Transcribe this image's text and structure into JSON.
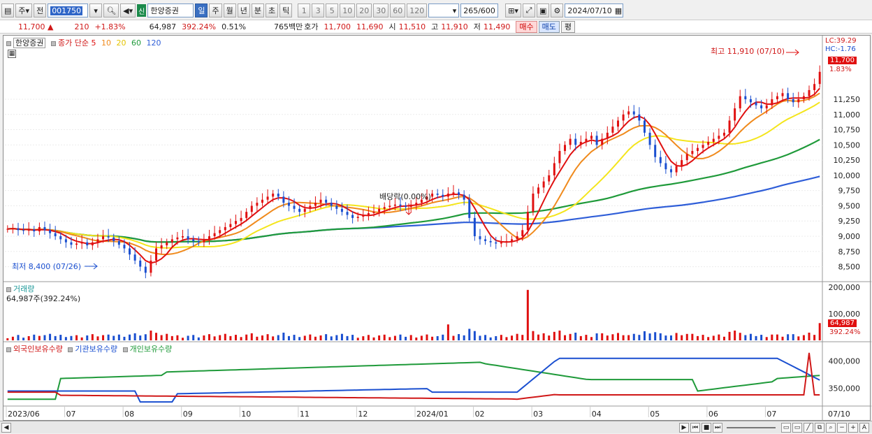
{
  "toolbar": {
    "period_btn": "주",
    "prev_btn": "전",
    "stock_code": "001750",
    "new_badge": "신",
    "stock_name": "한양증권",
    "tabs": [
      "일",
      "주",
      "월",
      "년",
      "분",
      "초",
      "틱"
    ],
    "active_tab": "일",
    "intervals": [
      "1",
      "3",
      "5",
      "10",
      "20",
      "30",
      "60",
      "120"
    ],
    "count": "265",
    "count_max": "/600",
    "date": "2024/07/10"
  },
  "quote": {
    "price": "11,700",
    "arrow": "▲",
    "change": "210",
    "change_pct": "+1.83%",
    "volume": "64,987",
    "vol_ratio": "392.24%",
    "turnover": "0.51%",
    "amount": "765백만",
    "hoga_label": "호가",
    "ask": "11,700",
    "bid": "11,690",
    "open_label": "시",
    "open": "11,510",
    "high_label": "고",
    "high": "11,910",
    "low_label": "저",
    "low": "11,490",
    "buy_btn": "매수",
    "sell_btn": "매도",
    "eval_btn": "평"
  },
  "price_panel": {
    "name": "한양증권",
    "ma_label": "종가 단순",
    "ma_periods": [
      {
        "label": "5",
        "color": "#e01010"
      },
      {
        "label": "10",
        "color": "#f08a1c"
      },
      {
        "label": "20",
        "color": "#f4e51c"
      },
      {
        "label": "60",
        "color": "#1f9a3a"
      },
      {
        "label": "120",
        "color": "#2f5ed8"
      }
    ],
    "lc": "LC:39.29",
    "hc": "HC:-1.76",
    "cur_price": "11,700",
    "cur_pct": "1.83%",
    "high_note": "최고 11,910 (07/10)",
    "low_note": "최저 8,400 (07/26)",
    "dividend_note": "배당락(0.00%)",
    "y_ticks": [
      "11,250",
      "11,000",
      "10,750",
      "10,500",
      "10,250",
      "10,000",
      "9,750",
      "9,500",
      "9,250",
      "9,000",
      "8,750",
      "8,500"
    ]
  },
  "volume_panel": {
    "title": "거래량",
    "subtitle": "64,987주(392.24%)",
    "y_ticks": [
      "200,000",
      "100,000"
    ],
    "cur": "64,987",
    "cur_pct": "392.24%"
  },
  "holding_panel": {
    "labels": [
      "외국인보유수량",
      "기관보유수량",
      "개인보유수량"
    ],
    "colors": [
      "#d01818",
      "#1a4fd0",
      "#1f9a3a"
    ],
    "y_ticks": [
      "400,000",
      "350,000"
    ]
  },
  "x_axis": [
    "2023/06",
    "07",
    "08",
    "09",
    "10",
    "11",
    "12",
    "2024/01",
    "02",
    "03",
    "04",
    "05",
    "06",
    "07"
  ],
  "x_end_label": "07/10",
  "chart_data": {
    "type": "candlestick",
    "ylim": [
      8300,
      11950
    ],
    "closes": [
      9120,
      9130,
      9100,
      9090,
      9110,
      9080,
      9150,
      9100,
      9050,
      9000,
      8950,
      8900,
      8860,
      8880,
      8900,
      8850,
      8900,
      8950,
      9000,
      8980,
      8920,
      8860,
      8800,
      8700,
      8600,
      8500,
      8400,
      8600,
      8800,
      8850,
      8900,
      8950,
      8980,
      9000,
      8950,
      8920,
      8900,
      8950,
      9000,
      9050,
      9100,
      9150,
      9200,
      9250,
      9300,
      9400,
      9500,
      9550,
      9600,
      9650,
      9700,
      9650,
      9550,
      9500,
      9450,
      9400,
      9450,
      9500,
      9550,
      9600,
      9550,
      9500,
      9450,
      9400,
      9350,
      9300,
      9320,
      9350,
      9380,
      9400,
      9450,
      9480,
      9500,
      9520,
      9500,
      9480,
      9520,
      9550,
      9600,
      9650,
      9700,
      9680,
      9650,
      9700,
      9720,
      9680,
      9600,
      9300,
      9000,
      8950,
      8920,
      8900,
      8880,
      8900,
      8920,
      8950,
      9000,
      9100,
      9400,
      9700,
      9800,
      9900,
      10000,
      10200,
      10400,
      10500,
      10600,
      10500,
      10550,
      10600,
      10650,
      10500,
      10600,
      10700,
      10800,
      10900,
      11000,
      11050,
      11000,
      10900,
      10700,
      10500,
      10300,
      10200,
      10100,
      10050,
      10150,
      10250,
      10350,
      10400,
      10450,
      10500,
      10550,
      10600,
      10650,
      10700,
      10900,
      11100,
      11300,
      11250,
      11200,
      11150,
      11100,
      11150,
      11250,
      11300,
      11350,
      11250,
      11200,
      11250,
      11300,
      11400,
      11500,
      11700
    ],
    "ma_periods": [
      5,
      10,
      20,
      60,
      120
    ],
    "volume_max": 200000,
    "holdings_ylim": [
      320000,
      420000
    ]
  }
}
